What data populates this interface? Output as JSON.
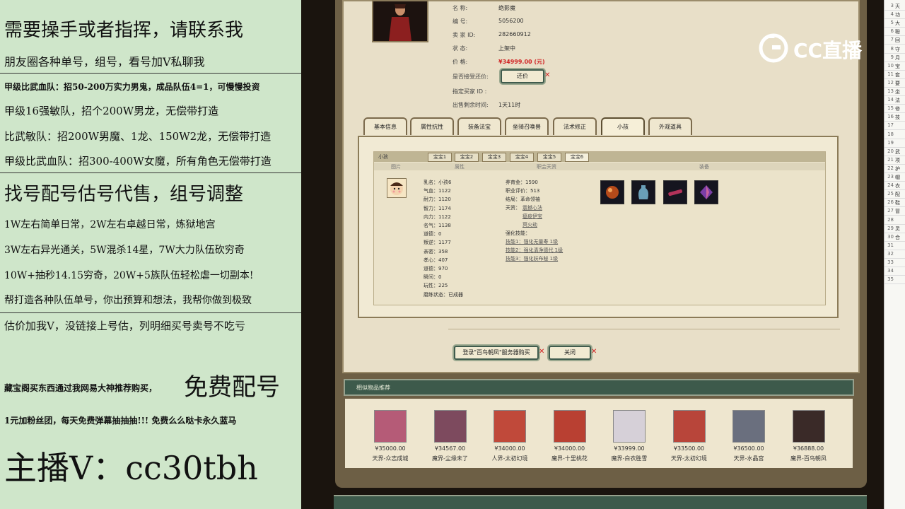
{
  "left_overlay": {
    "lines": [
      "需要操手或者指挥，请联系我",
      "朋友圈各种单号，组号，看号加V私聊我",
      "甲级比武血队：招50-200万实力男鬼，成品队伍4=1，可慢慢投资",
      "甲级16强敏队，招个200W男龙，无偿带打造",
      "比武敏队：招200W男魔、1龙、150W2龙，无偿带打造",
      "甲级比武血队：招300-400W女魔，所有角色无偿带打造",
      "找号配号估号代售，组号调整",
      "1W左右简单日常，2W左右卓越日常，炼狱地宫",
      "3W左右异光通关，5W混杀14星，7W大力队伍砍穷奇",
      "10W+抽秒14.15穷奇，20W+5族队伍轻松虐一切副本!",
      "帮打造各种队伍单号，你出预算和想法，我帮你做到极致",
      "估价加我V，没链接上号估，列明细买号卖号不吃亏",
      "藏宝阁买东西通过我网易大神推荐购买，",
      "免费配号",
      "1元加粉丝团，每天免费弹幕抽抽抽!!! 免费么么哒卡永久蓝马",
      "主播V：cc30tbh"
    ]
  },
  "item": {
    "name_label": "名    称:",
    "name": "绝影魔",
    "id_label": "编    号:",
    "id": "5056200",
    "seller_label": "卖  家  ID:",
    "seller_id": "282660912",
    "status_label": "状    态:",
    "status": "上架中",
    "price_label": "价    格:",
    "price": "¥34999.00 (元)",
    "bargain_label": "是否接受还价:",
    "bargain_button": "还价",
    "buyer_label": "指定买家 ID :",
    "time_label": "出售剩余时间:",
    "time_left": "1天11时"
  },
  "tabs": [
    "基本信息",
    "属性抗性",
    "装备法宝",
    "坐骑召唤兽",
    "法术修正",
    "小孩",
    "外观道具"
  ],
  "active_tab": "小孩",
  "child_panel": {
    "title": "小孩",
    "subtabs": [
      "宝宝1",
      "宝宝2",
      "宝宝3",
      "宝宝4",
      "宝宝5",
      "宝宝6"
    ],
    "col_headers": [
      "图片",
      "属性",
      "职会天资",
      "装备"
    ],
    "stats": [
      "乳名：小孩6",
      "气血：1122",
      "耐力：1120",
      "智力：1174",
      "内力：1122",
      "名气：1138",
      "道德：0",
      "叛逆：1177",
      "亲密：358",
      "孝心：407",
      "道德：970",
      "瞬间：0",
      "玩性：225",
      "磨练状态：已成器"
    ],
    "skills_info": {
      "money": "养育金：1590",
      "rating": "职业评价：513",
      "ending": "结局：革命领袖",
      "talent_label": "天资：",
      "talents": [
        "震撼心法",
        "瘟疫伊宝",
        "冥火劫"
      ],
      "enhance_label": "强化技能：",
      "enhance": [
        "技能1：强化无量寿 1级",
        "技能2：强化清净德代 1级",
        "技能3：强化妖布秘 1级"
      ]
    }
  },
  "buttons": {
    "login_buy": "登录\"百鸟朝凤\"服务器购买",
    "close": "关闭"
  },
  "similar": {
    "title": "相似物品推荐",
    "items": [
      {
        "price": "¥35000.00",
        "name": "天界-众志成城",
        "color": "#b55b77"
      },
      {
        "price": "¥34567.00",
        "name": "魔界-尘缘未了",
        "color": "#7d4a5e"
      },
      {
        "price": "¥34000.00",
        "name": "人界-太初幻境",
        "color": "#c0493a"
      },
      {
        "price": "¥34000.00",
        "name": "魔界-十里桃花",
        "color": "#b94032"
      },
      {
        "price": "¥33999.00",
        "name": "魔界-白衣胜雪",
        "color": "#d6d0d8"
      },
      {
        "price": "¥33500.00",
        "name": "天界-太初幻境",
        "color": "#b8453a"
      },
      {
        "price": "¥36500.00",
        "name": "天界-水晶宫",
        "color": "#6a6f7e"
      },
      {
        "price": "¥36888.00",
        "name": "魔界-百鸟朝凤",
        "color": "#3a2a28"
      }
    ]
  },
  "watermark": "CC直播",
  "spreadsheet": {
    "rows": [
      [
        "3",
        "天"
      ],
      [
        "4",
        "功"
      ],
      [
        "5",
        "大"
      ],
      [
        "6",
        "聪"
      ],
      [
        "7",
        "回"
      ],
      [
        "8",
        "守"
      ],
      [
        "9",
        "月"
      ],
      [
        "10",
        "宝"
      ],
      [
        "11",
        "套"
      ],
      [
        "12",
        "要"
      ],
      [
        "13",
        "坐"
      ],
      [
        "14",
        "法"
      ],
      [
        "15",
        "修"
      ],
      [
        "16",
        "技"
      ],
      [
        "17",
        ""
      ],
      [
        "18",
        ""
      ],
      [
        "19",
        ""
      ],
      [
        "20",
        "武"
      ],
      [
        "21",
        "项"
      ],
      [
        "22",
        "护"
      ],
      [
        "23",
        "帽"
      ],
      [
        "24",
        "衣"
      ],
      [
        "25",
        "配"
      ],
      [
        "26",
        "鞋"
      ],
      [
        "27",
        "冒"
      ],
      [
        "28",
        ""
      ],
      [
        "29",
        "灵"
      ],
      [
        "30",
        "合"
      ],
      [
        "31",
        ""
      ],
      [
        "32",
        ""
      ],
      [
        "33",
        ""
      ],
      [
        "34",
        ""
      ],
      [
        "35",
        ""
      ]
    ]
  }
}
